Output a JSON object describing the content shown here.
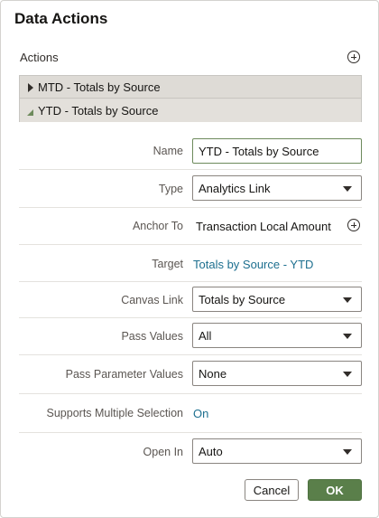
{
  "dialog": {
    "title": "Data Actions"
  },
  "actions": {
    "label": "Actions",
    "add_icon": "circle-plus-icon",
    "items": [
      {
        "label": "MTD - Totals by Source",
        "expanded": false
      },
      {
        "label": "YTD - Totals by Source",
        "expanded": true
      }
    ]
  },
  "form": {
    "name": {
      "label": "Name",
      "value": "YTD - Totals by Source"
    },
    "type": {
      "label": "Type",
      "value": "Analytics Link"
    },
    "anchor_to": {
      "label": "Anchor To",
      "value": "Transaction Local Amount"
    },
    "target": {
      "label": "Target",
      "value": "Totals by Source - YTD"
    },
    "canvas_link": {
      "label": "Canvas Link",
      "value": "Totals by Source"
    },
    "pass_values": {
      "label": "Pass Values",
      "value": "All"
    },
    "pass_parameter_values": {
      "label": "Pass Parameter Values",
      "value": "None"
    },
    "supports_multiple_selection": {
      "label": "Supports Multiple Selection",
      "value": "On"
    },
    "open_in": {
      "label": "Open In",
      "value": "Auto"
    }
  },
  "buttons": {
    "cancel": "Cancel",
    "ok": "OK"
  },
  "colors": {
    "accent": "#5a7f4a",
    "link": "#1d6f8f",
    "tree_bg": "#dedbd6"
  }
}
